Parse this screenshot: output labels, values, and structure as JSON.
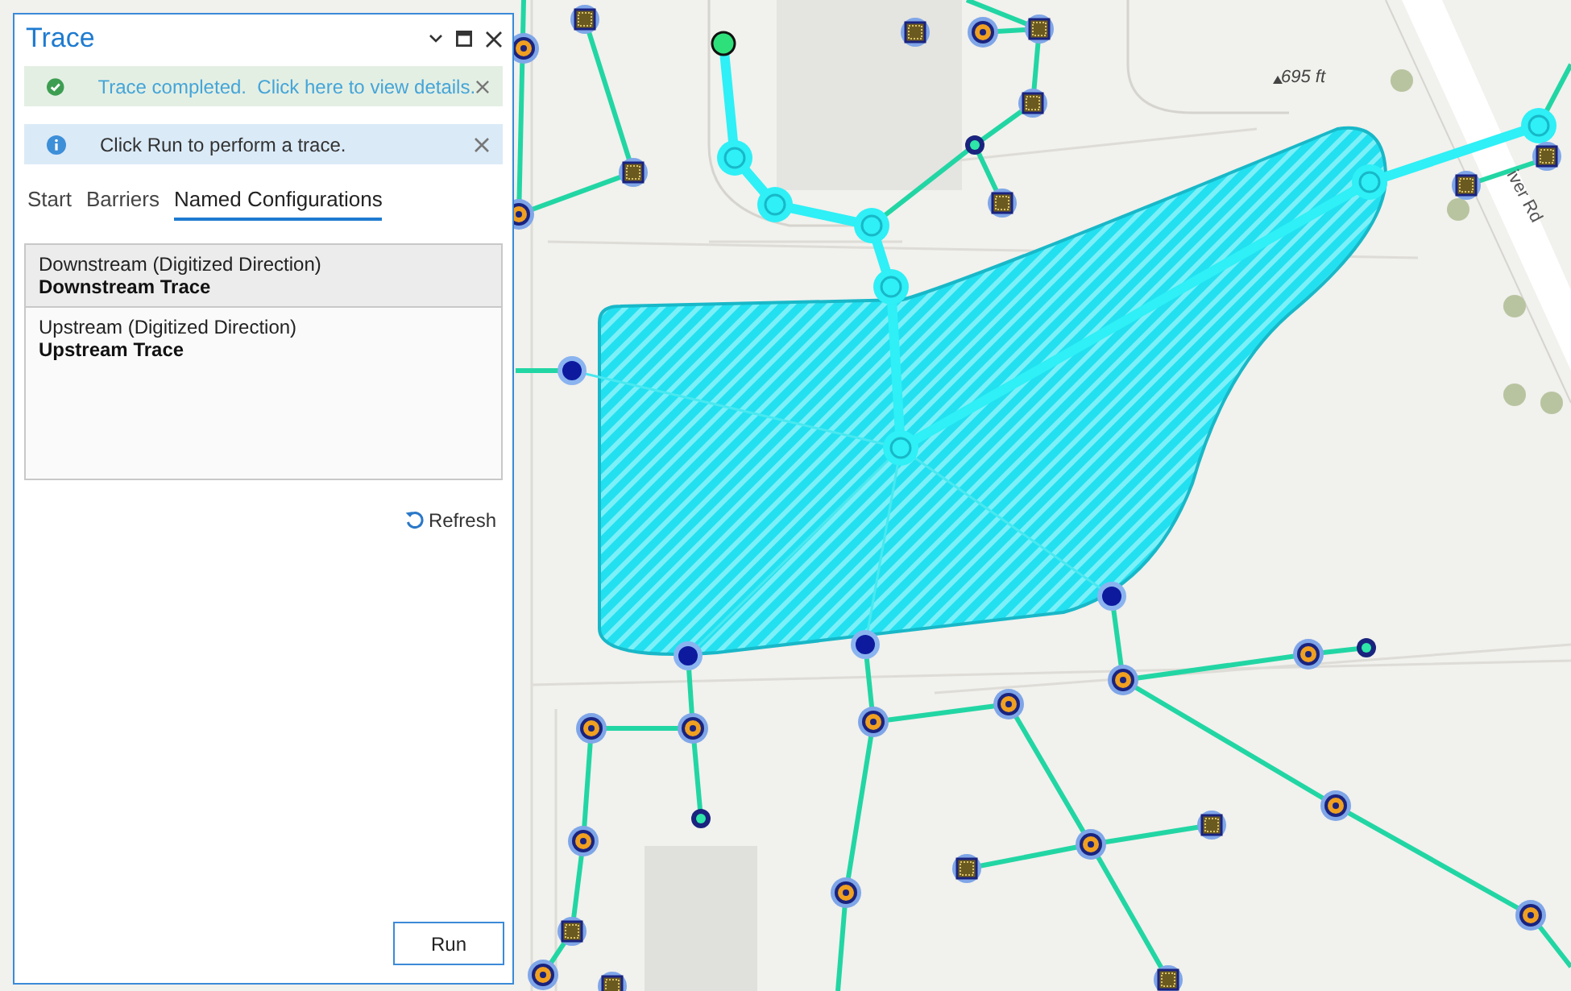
{
  "panel": {
    "title": "Trace",
    "messages": [
      {
        "kind": "success",
        "text": "Trace completed.  Click here to view details."
      },
      {
        "kind": "info",
        "text": "Click Run to perform a trace."
      }
    ],
    "tabs": [
      {
        "label": "Start",
        "selected": false
      },
      {
        "label": "Barriers",
        "selected": false
      },
      {
        "label": "Named Configurations",
        "selected": true
      }
    ],
    "configurations": [
      {
        "name": "Downstream (Digitized Direction)",
        "trace": "Downstream Trace",
        "selected": true
      },
      {
        "name": "Upstream (Digitized Direction)",
        "trace": "Upstream Trace",
        "selected": false
      }
    ],
    "refresh": "Refresh",
    "run": "Run"
  },
  "map": {
    "labels": [
      {
        "kind": "elevation",
        "text": "695 ft"
      },
      {
        "kind": "road",
        "text": "iver Rd"
      }
    ]
  }
}
